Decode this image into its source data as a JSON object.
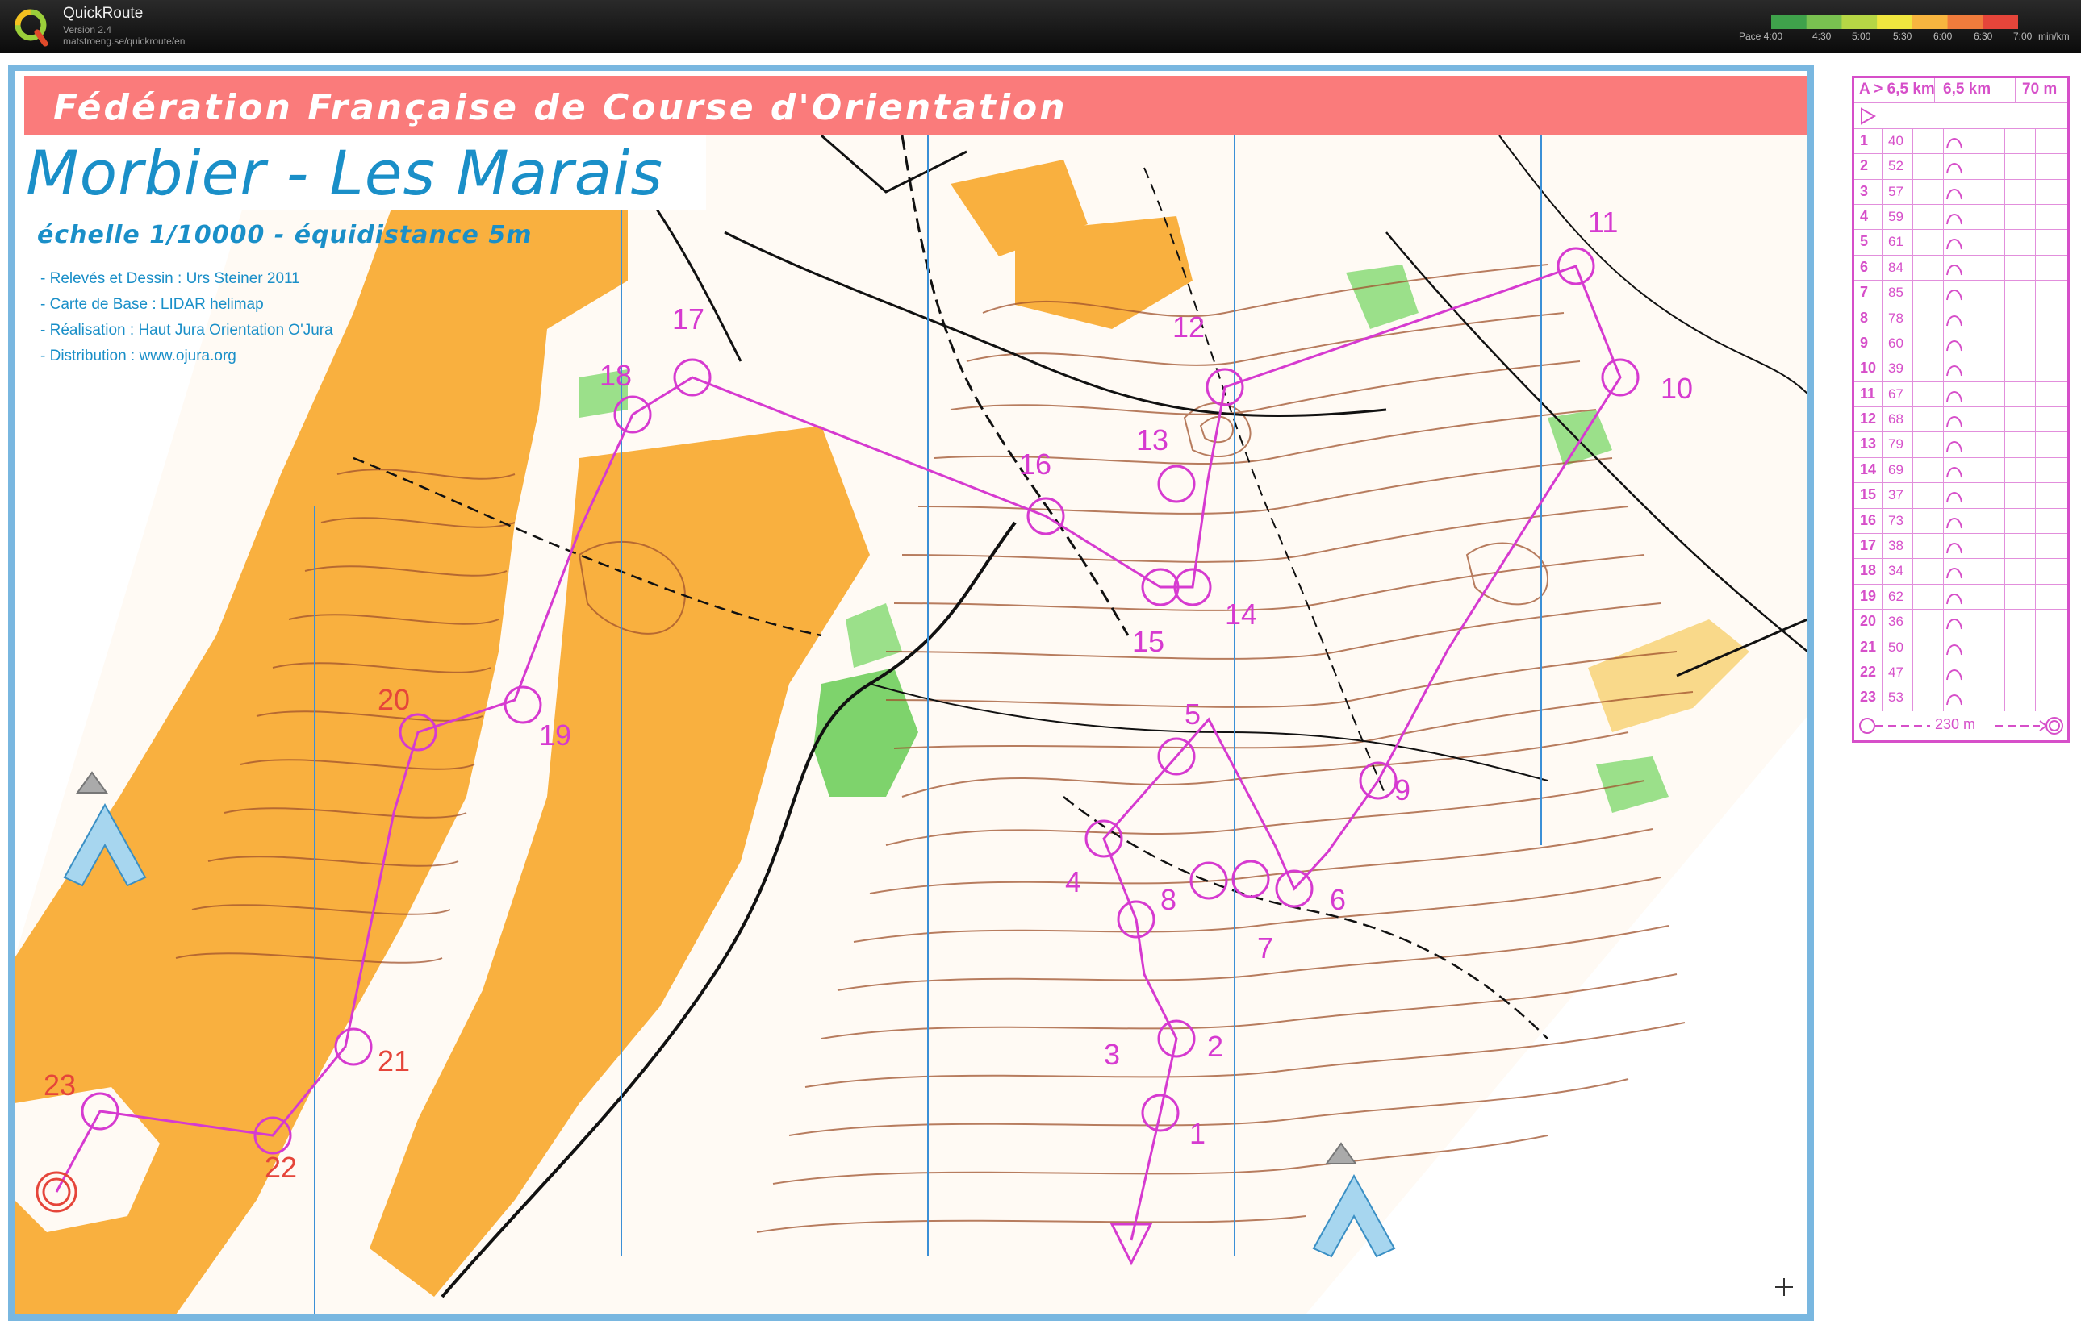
{
  "app": {
    "title": "QuickRoute",
    "version": "Version 2.4",
    "url": "matstroeng.se/quickroute/en",
    "pace_labels": [
      "Pace 4:00",
      "4:30",
      "5:00",
      "5:30",
      "6:00",
      "6:30",
      "7:00",
      "min/km"
    ],
    "pace_colors": [
      "#3fa24b",
      "#79c150",
      "#b6d645",
      "#f0e63f",
      "#f7b53f",
      "#f07c3c",
      "#e5453a"
    ]
  },
  "map": {
    "federation": "Fédération Française de Course d'Orientation",
    "title": "Morbier - Les Marais",
    "subtitle": "échelle 1/10000 - équidistance 5m",
    "credits": [
      "- Relevés et Dessin :  Urs Steiner 2011",
      "- Carte de Base :  LIDAR helimap",
      "- Réalisation : Haut Jura Orientation O'Jura",
      "- Distribution : www.ojura.org"
    ],
    "colors": {
      "banner": "#fa7b7b",
      "title_blue": "#1a8fc8",
      "open_land": "#f9b03f",
      "forest_green": "#7ed36c",
      "course_magenta": "#d63ad0",
      "frame_blue": "#79b7e0"
    },
    "control_labels": [
      "1",
      "2",
      "3",
      "4",
      "5",
      "6",
      "7",
      "8",
      "9",
      "10",
      "11",
      "12",
      "13",
      "14",
      "15",
      "16",
      "17",
      "18",
      "19",
      "20",
      "21",
      "22",
      "23"
    ]
  },
  "control_description": {
    "class": "A > 6,5 km",
    "length": "6,5 km",
    "climb": "70 m",
    "start_symbol": "start-triangle-icon",
    "controls": [
      {
        "n": "1",
        "code": "40"
      },
      {
        "n": "2",
        "code": "52"
      },
      {
        "n": "3",
        "code": "57"
      },
      {
        "n": "4",
        "code": "59"
      },
      {
        "n": "5",
        "code": "61"
      },
      {
        "n": "6",
        "code": "84"
      },
      {
        "n": "7",
        "code": "85"
      },
      {
        "n": "8",
        "code": "78"
      },
      {
        "n": "9",
        "code": "60"
      },
      {
        "n": "10",
        "code": "39"
      },
      {
        "n": "11",
        "code": "67"
      },
      {
        "n": "12",
        "code": "68"
      },
      {
        "n": "13",
        "code": "79"
      },
      {
        "n": "14",
        "code": "69"
      },
      {
        "n": "15",
        "code": "37"
      },
      {
        "n": "16",
        "code": "73"
      },
      {
        "n": "17",
        "code": "38"
      },
      {
        "n": "18",
        "code": "34"
      },
      {
        "n": "19",
        "code": "62"
      },
      {
        "n": "20",
        "code": "36"
      },
      {
        "n": "21",
        "code": "50"
      },
      {
        "n": "22",
        "code": "47"
      },
      {
        "n": "23",
        "code": "53"
      }
    ],
    "finish_distance": "230 m"
  }
}
